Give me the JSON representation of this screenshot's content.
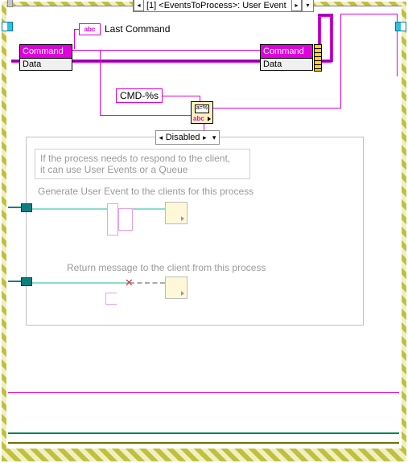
{
  "event_selector": {
    "prev": "◂",
    "label": "[1] <EventsToProcess>: User Event",
    "next": "▸",
    "dropdown": "▾"
  },
  "last_command_label": "Last Command",
  "abc_glyph": "abc",
  "cluster_left": {
    "head": "Command",
    "row": "Data"
  },
  "cluster_right": {
    "head": "Command",
    "row": "Data"
  },
  "fmt_string": "CMD-%s",
  "fmt_node_caption": "a=%",
  "disabled": {
    "selector": {
      "prev": "◂",
      "label": "Disabled",
      "next": "▸",
      "dropdown": "▾"
    },
    "note_line1": "If the process needs to respond to the client,",
    "note_line2": "it can use User Events or a Queue",
    "caption_event": "Generate User Event to the clients for this process",
    "caption_return": "Return message to the client from this process"
  }
}
